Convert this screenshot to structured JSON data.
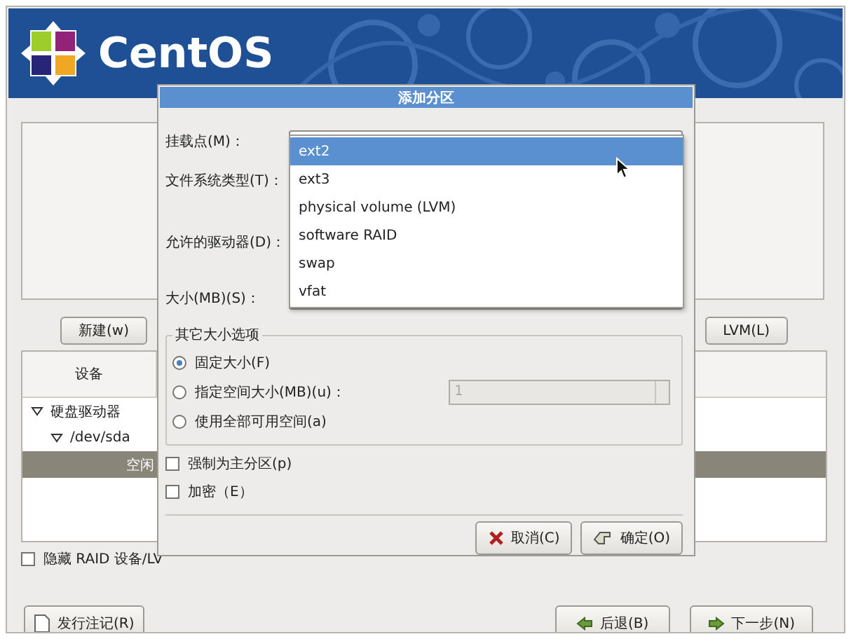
{
  "banner": {
    "logo_text": "CentOS"
  },
  "main": {
    "buttons": [
      {
        "label": "新建(w)"
      },
      {
        "label": "LVM(L)"
      }
    ],
    "table": {
      "columns": [
        "设备"
      ],
      "rows": [
        {
          "label": "硬盘驱动器",
          "expanded": true,
          "selected": false,
          "children": [
            {
              "label": "/dev/sda",
              "expanded": true,
              "selected": false,
              "children": [
                {
                  "label": "空闲",
                  "selected": true
                }
              ]
            }
          ]
        }
      ]
    },
    "hide_checkbox": {
      "label": "隐藏 RAID 设备/LV",
      "checked": false
    }
  },
  "footer": {
    "release_notes": "发行注记(R)",
    "back": "后退(B)",
    "next": "下一步(N)"
  },
  "dialog": {
    "title": "添加分区",
    "fields": [
      "挂载点(M)：",
      "文件系统类型(T)：",
      "允许的驱动器(D)：",
      "大小(MB)(S)："
    ],
    "size_group": {
      "title": "其它大小选项",
      "options": [
        {
          "label": "固定大小(F)",
          "selected": true
        },
        {
          "label": "指定空间大小(MB)(u)：",
          "selected": false
        },
        {
          "label": "使用全部可用空间(a)",
          "selected": false
        }
      ],
      "spin_value": "1",
      "spin_disabled": true
    },
    "checkboxes": [
      {
        "label": "强制为主分区(p)",
        "checked": false
      },
      {
        "label": "加密（E）",
        "checked": false
      }
    ],
    "buttons": [
      {
        "kind": "cancel",
        "label": "取消(C)"
      },
      {
        "kind": "ok",
        "label": "确定(O)"
      }
    ],
    "dropdown": [
      {
        "label": "ext2",
        "selected": true
      },
      {
        "label": "ext3",
        "selected": false
      },
      {
        "label": "physical volume (LVM)",
        "selected": false
      },
      {
        "label": "software RAID",
        "selected": false
      },
      {
        "label": "swap",
        "selected": false
      },
      {
        "label": "vfat",
        "selected": false
      }
    ]
  }
}
